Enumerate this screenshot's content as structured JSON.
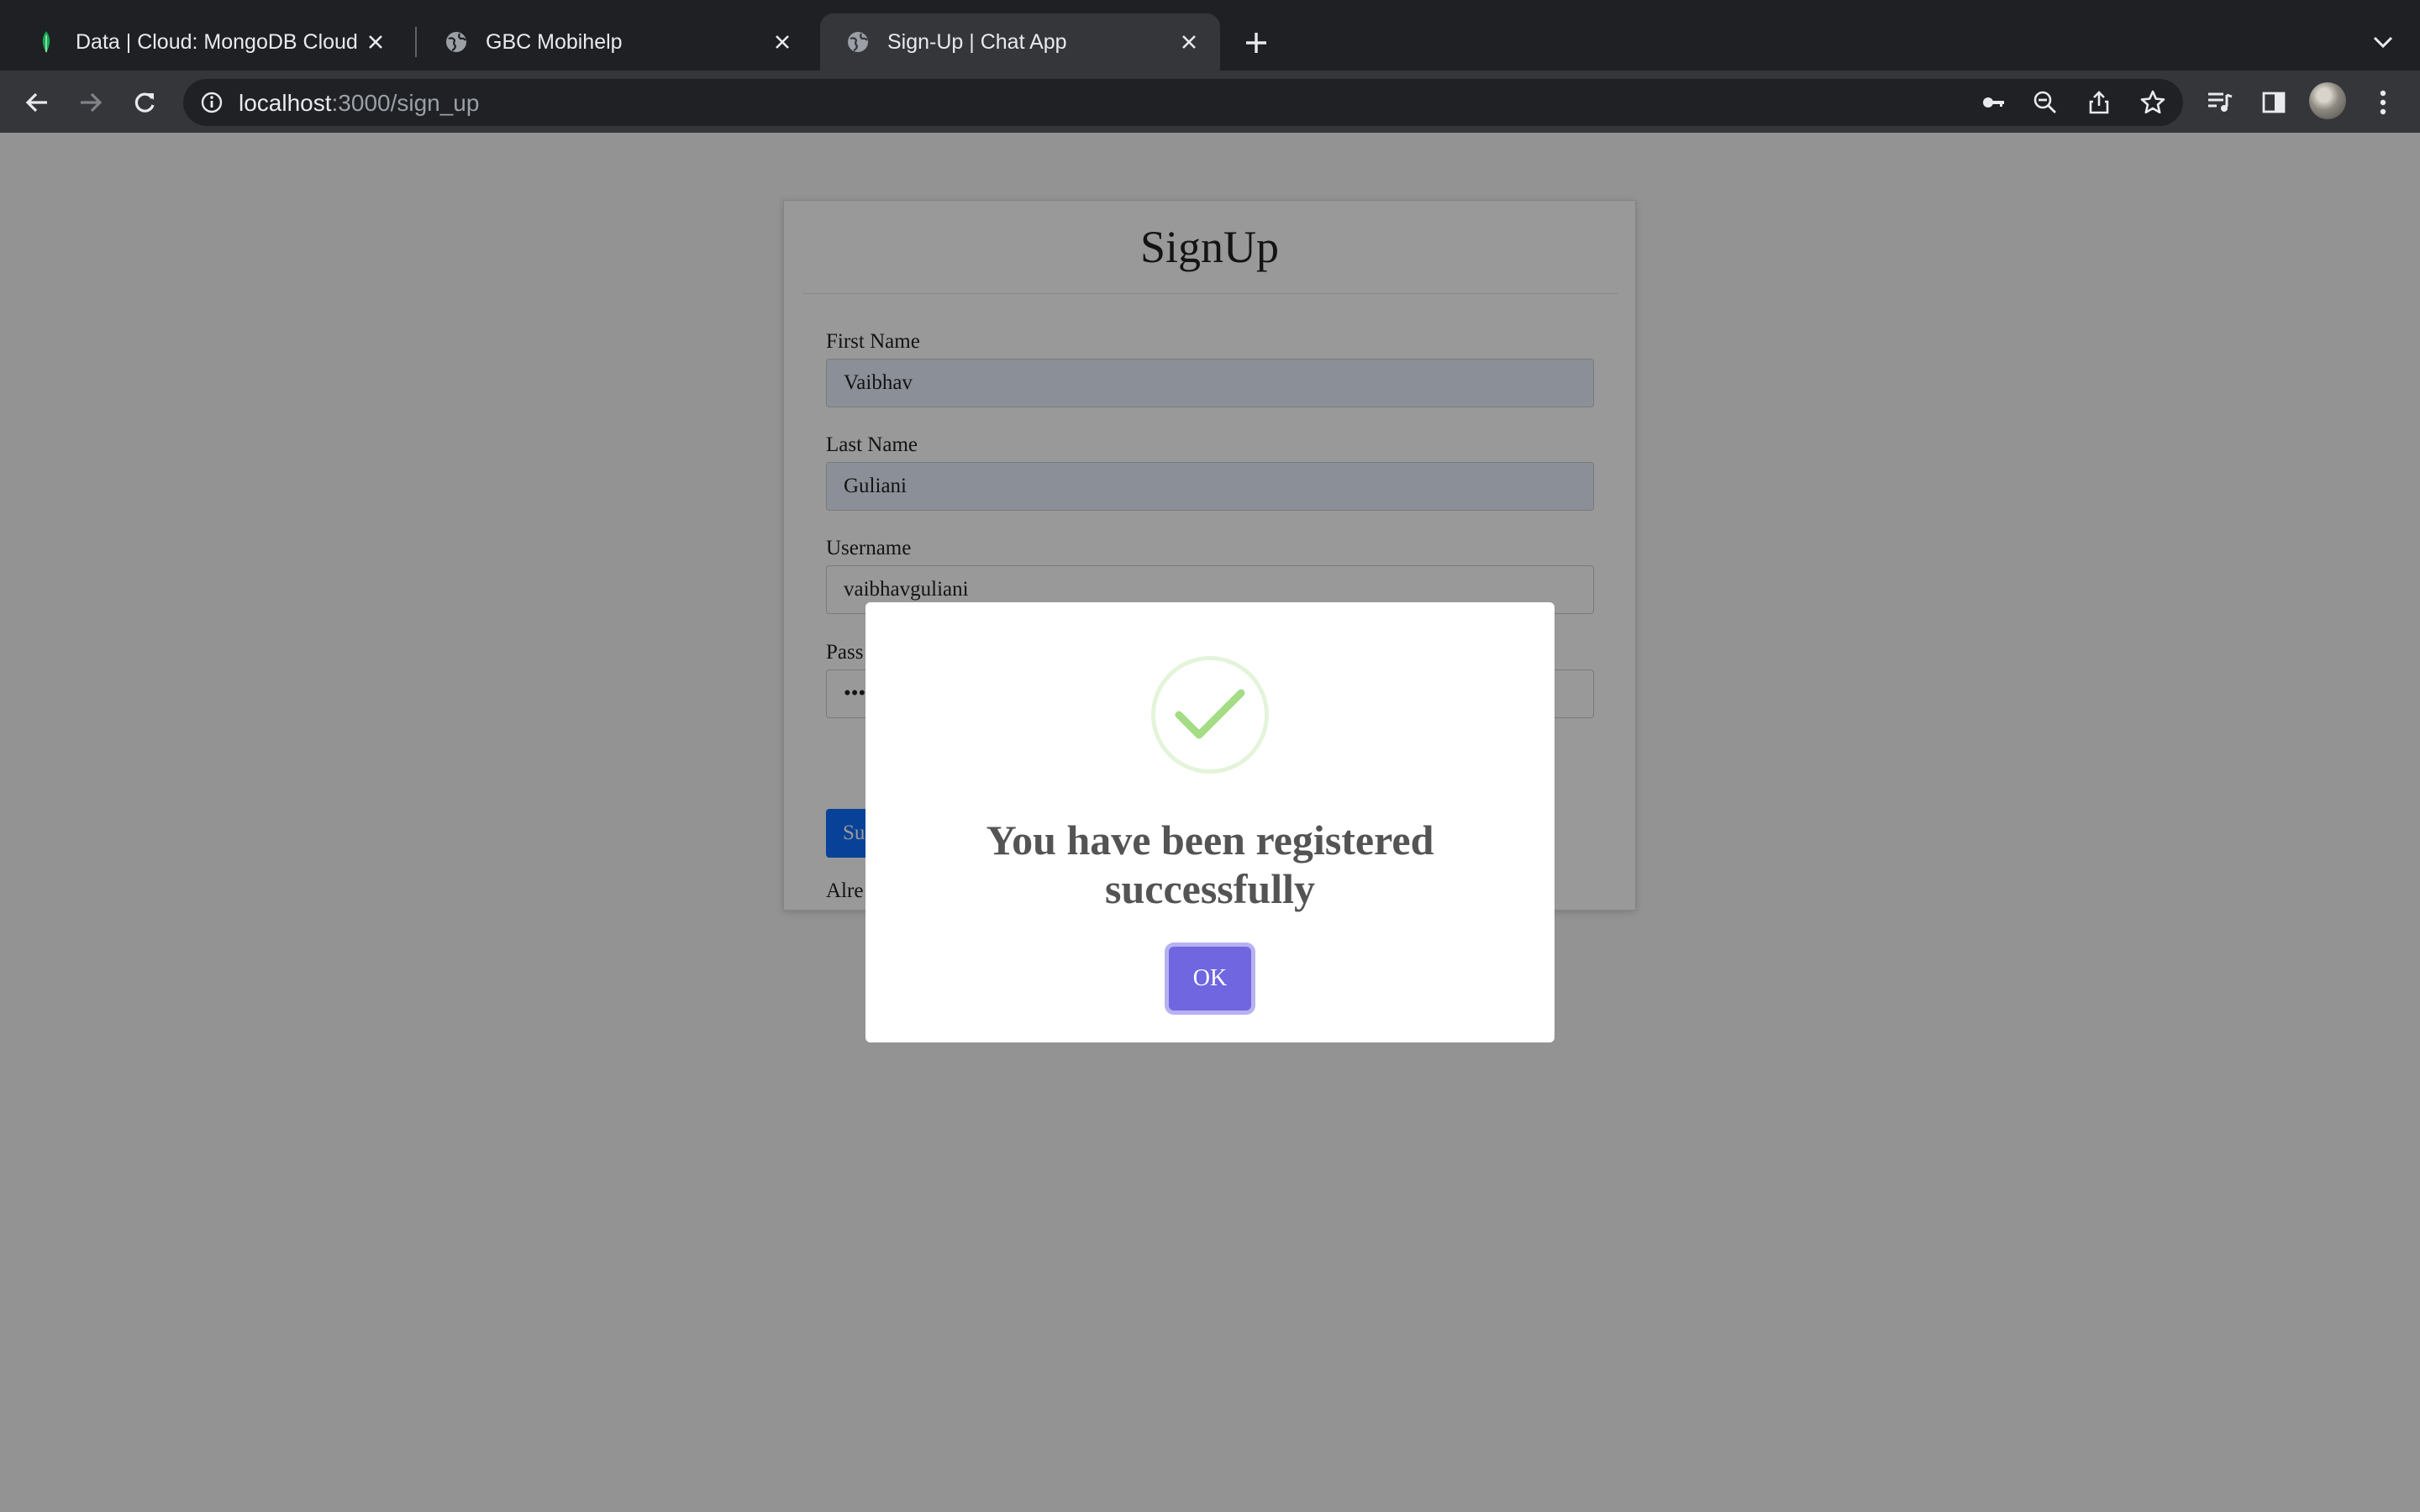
{
  "browser": {
    "tabs": [
      {
        "title": "Data | Cloud: MongoDB Cloud",
        "favicon": "mongodb-leaf-icon",
        "active": false
      },
      {
        "title": "GBC Mobihelp",
        "favicon": "globe-icon",
        "active": false
      },
      {
        "title": "Sign-Up | Chat App",
        "favicon": "globe-icon",
        "active": true
      }
    ],
    "url_host": "localhost",
    "url_path": ":3000/sign_up"
  },
  "form": {
    "title": "SignUp",
    "fields": [
      {
        "label": "First Name",
        "value": "Vaibhav"
      },
      {
        "label": "Last Name",
        "value": "Guliani"
      },
      {
        "label": "Username",
        "value": "vaibhavguliani"
      },
      {
        "label": "Pass",
        "value": "•••"
      }
    ],
    "submit_label": "Su",
    "footer_text": "Alre"
  },
  "modal": {
    "icon": "success-check-icon",
    "title": "You have been registered successfully",
    "ok_label": "OK"
  },
  "colors": {
    "confirm_button": "#7066e0",
    "success_check": "#a5dc86",
    "submit_button": "#0d6efd",
    "autofill_bg": "#e8f0fe"
  }
}
